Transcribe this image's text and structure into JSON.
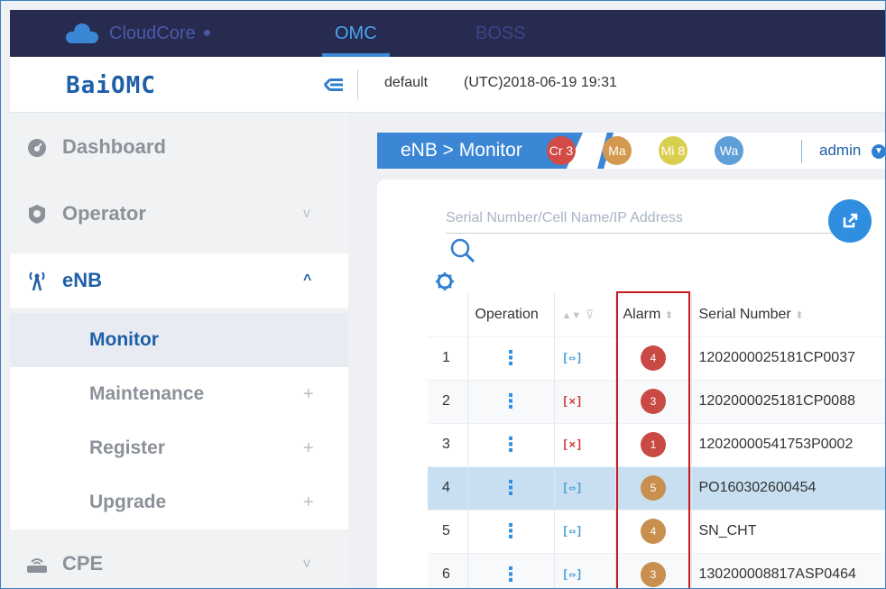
{
  "topnav": {
    "brand": "CloudCore",
    "tabs": [
      {
        "label": "OMC",
        "active": true
      },
      {
        "label": "BOSS",
        "active": false
      }
    ]
  },
  "header": {
    "logo": "BaiOMC",
    "tenant": "default",
    "datetime": "(UTC)2018-06-19 19:31"
  },
  "sidebar": {
    "items": [
      {
        "label": "Dashboard",
        "icon": "dashboard-icon"
      },
      {
        "label": "Operator",
        "icon": "operator-icon",
        "arrow": "v"
      },
      {
        "label": "eNB",
        "icon": "antenna-icon",
        "arrow": "^",
        "open": true
      },
      {
        "label": "CPE",
        "icon": "router-icon",
        "arrow": "v"
      }
    ],
    "subitems": [
      {
        "label": "Monitor",
        "active": true
      },
      {
        "label": "Maintenance",
        "plus": "+"
      },
      {
        "label": "Register",
        "plus": "+"
      },
      {
        "label": "Upgrade",
        "plus": "+"
      }
    ]
  },
  "breadcrumb": {
    "text": "eNB > Monitor",
    "alarms": [
      {
        "label": "Cr 3",
        "color": "#d24b47"
      },
      {
        "label": "Ma",
        "color": "#d39a4f"
      },
      {
        "label": "Mi 8",
        "color": "#d9cf4f"
      },
      {
        "label": "Wa",
        "color": "#5f9fd8"
      }
    ],
    "user": "admin"
  },
  "search": {
    "placeholder": "Serial Number/Cell Name/IP Address"
  },
  "table": {
    "columns": [
      "",
      "Operation",
      "",
      "Alarm",
      "Serial Number"
    ],
    "rows": [
      {
        "idx": "1",
        "link": "ok",
        "alarm": "4",
        "alarm_color": "#c94a45",
        "serial": "1202000025181CP0037"
      },
      {
        "idx": "2",
        "link": "bad",
        "alarm": "3",
        "alarm_color": "#c94a45",
        "serial": "1202000025181CP0088"
      },
      {
        "idx": "3",
        "link": "bad",
        "alarm": "1",
        "alarm_color": "#c94a45",
        "serial": "12020000541753P0002"
      },
      {
        "idx": "4",
        "link": "ok",
        "alarm": "5",
        "alarm_color": "#c98f4e",
        "serial": "PO160302600454",
        "selected": true
      },
      {
        "idx": "5",
        "link": "ok",
        "alarm": "4",
        "alarm_color": "#c98f4e",
        "serial": "SN_CHT"
      },
      {
        "idx": "6",
        "link": "ok",
        "alarm": "3",
        "alarm_color": "#c98f4e",
        "serial": "130200008817ASP0464"
      }
    ]
  }
}
